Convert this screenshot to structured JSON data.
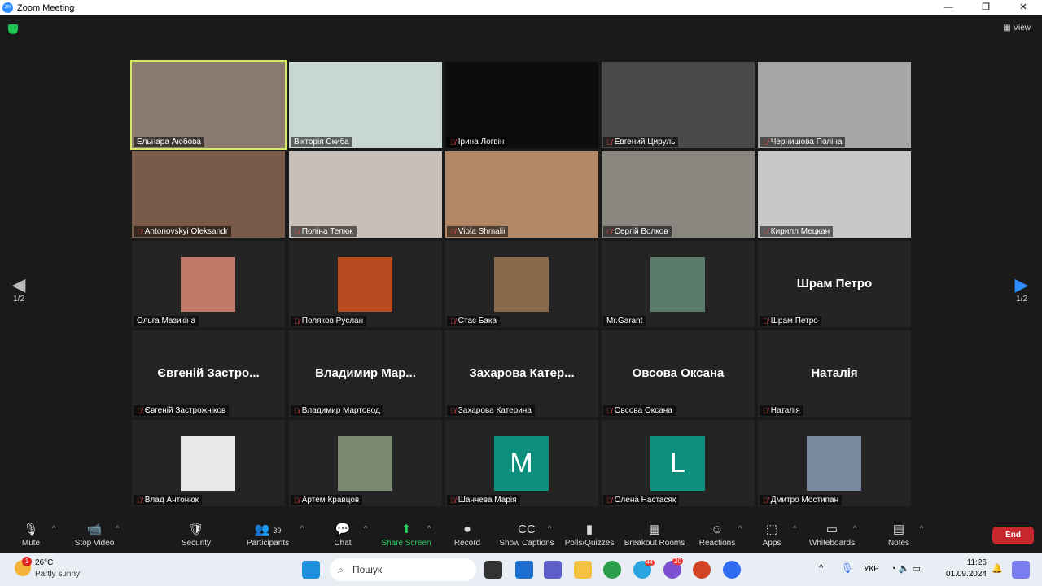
{
  "window": {
    "title": "Zoom Meeting",
    "view_label": "View"
  },
  "nav": {
    "page": "1/2"
  },
  "tiles": [
    {
      "name": "Ельнара Аюбова",
      "type": "video",
      "color": "#8a7a70",
      "active": true,
      "muted": false
    },
    {
      "name": "Вікторія Скиба",
      "type": "video",
      "color": "#c8d8d0",
      "muted": false
    },
    {
      "name": "Ірина Логвін",
      "type": "video",
      "color": "#0d0d0d",
      "muted": true
    },
    {
      "name": "Евгений Цируль",
      "type": "video",
      "color": "#4a4a48",
      "muted": true
    },
    {
      "name": "Чернишова Поліна",
      "type": "video",
      "color": "#a8a6a4",
      "muted": true
    },
    {
      "name": "Antonovskyi Oleksandr",
      "type": "video",
      "color": "#7a5a48",
      "muted": true
    },
    {
      "name": "Поліна Телюк",
      "type": "video",
      "color": "#c8bfb8",
      "muted": true
    },
    {
      "name": "Viola Shmalii",
      "type": "video",
      "color": "#b08868",
      "muted": true
    },
    {
      "name": "Сергій Волков",
      "type": "video",
      "color": "#8a8680",
      "muted": true
    },
    {
      "name": "Кирилл Мецкан",
      "type": "video",
      "color": "#c8c8c8",
      "muted": true
    },
    {
      "name": "Ольга Мазикіна",
      "type": "photo",
      "color": "#c07868",
      "muted": false
    },
    {
      "name": "Поляков Руслан",
      "type": "photo",
      "color": "#b84a20",
      "muted": true
    },
    {
      "name": "Стас Бака",
      "type": "photo",
      "color": "#8a6a48",
      "muted": true
    },
    {
      "name": "Mr.Garant",
      "type": "photo",
      "color": "#5a7a6a",
      "muted": false
    },
    {
      "name": "Шрам Петро",
      "type": "name",
      "display": "Шрам Петро",
      "muted": true
    },
    {
      "name": "Євгеній Застрожніков",
      "type": "name",
      "display": "Євгеній Застро...",
      "muted": true
    },
    {
      "name": "Владимир Мартовод",
      "type": "name",
      "display": "Владимир  Мар...",
      "muted": true
    },
    {
      "name": "Захарова Катерина",
      "type": "name",
      "display": "Захарова  Катер...",
      "muted": true
    },
    {
      "name": "Овсова Оксана",
      "type": "name",
      "display": "Овсова Оксана",
      "muted": true
    },
    {
      "name": "Наталія",
      "type": "name",
      "display": "Наталія",
      "muted": true
    },
    {
      "name": "Влад Антонюк",
      "type": "photo",
      "color": "#e8e8e8",
      "muted": true
    },
    {
      "name": "Артем Кравцов",
      "type": "photo",
      "color": "#7a8a70",
      "muted": true
    },
    {
      "name": "Шанчева Марія",
      "type": "letter",
      "letter": "M",
      "muted": true
    },
    {
      "name": "Олена Настасяк",
      "type": "letter",
      "letter": "L",
      "muted": true
    },
    {
      "name": "Дмитро Мостипан",
      "type": "photo",
      "color": "#7a8aa0",
      "muted": true
    }
  ],
  "toolbar": {
    "items": [
      {
        "label": "Mute",
        "icon": "🎙",
        "caret": true
      },
      {
        "label": "Stop Video",
        "icon": "📹",
        "caret": true
      },
      {
        "label": "Security",
        "icon": "🛡",
        "caret": false
      },
      {
        "label": "Participants",
        "icon": "👥",
        "count": "39",
        "caret": true
      },
      {
        "label": "Chat",
        "icon": "💬",
        "caret": true
      },
      {
        "label": "Share Screen",
        "icon": "⬆",
        "caret": true
      },
      {
        "label": "Record",
        "icon": "⏺",
        "caret": false
      },
      {
        "label": "Show Captions",
        "icon": "CC",
        "caret": true
      },
      {
        "label": "Polls/Quizzes",
        "icon": "▮",
        "caret": false
      },
      {
        "label": "Breakout Rooms",
        "icon": "▦",
        "caret": false
      },
      {
        "label": "Reactions",
        "icon": "☺",
        "caret": true
      },
      {
        "label": "Apps",
        "icon": "⬚",
        "caret": true
      },
      {
        "label": "Whiteboards",
        "icon": "▭",
        "caret": true
      },
      {
        "label": "Notes",
        "icon": "▤",
        "caret": true
      }
    ],
    "end_label": "End"
  },
  "taskbar": {
    "weather_temp": "26°C",
    "weather_desc": "Partly sunny",
    "weather_badge": "1",
    "search_placeholder": "Пошук",
    "telegram_badge": "44",
    "viber_badge": "20",
    "language": "УКР",
    "time": "11:26",
    "date": "01.09.2024"
  }
}
